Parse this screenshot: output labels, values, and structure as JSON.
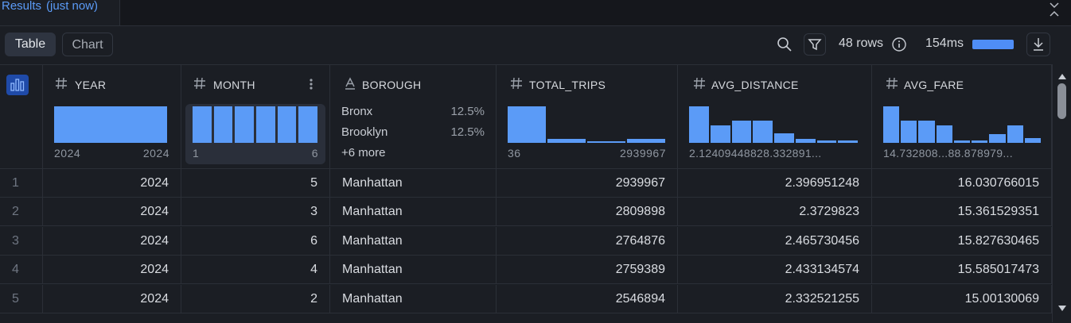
{
  "tab": {
    "title": "Results",
    "status": "(just now)"
  },
  "toolbar": {
    "table_label": "Table",
    "chart_label": "Chart",
    "rows_text": "48 rows",
    "time_text": "154ms",
    "icons": [
      "search-icon",
      "filter-icon",
      "info-icon",
      "download-icon"
    ]
  },
  "columns": [
    {
      "name": "YEAR",
      "type_icon": "hash-icon",
      "range_min": "2024",
      "range_max": "2024"
    },
    {
      "name": "MONTH",
      "type_icon": "hash-icon",
      "range_min": "1",
      "range_max": "6"
    },
    {
      "name": "BOROUGH",
      "type_icon": "text-type-icon",
      "categories": [
        {
          "label": "Bronx",
          "pct": "12.5%"
        },
        {
          "label": "Brooklyn",
          "pct": "12.5%"
        }
      ],
      "more": "+6 more"
    },
    {
      "name": "TOTAL_TRIPS",
      "type_icon": "hash-icon",
      "range_min": "36",
      "range_max": "2939967"
    },
    {
      "name": "AVG_DISTANCE",
      "type_icon": "hash-icon",
      "range_text": "2.12409448828.332891..."
    },
    {
      "name": "AVG_FARE",
      "type_icon": "hash-icon",
      "range_text": "14.732808...88.878979..."
    }
  ],
  "histograms": {
    "year": [
      1
    ],
    "month": [
      1,
      1,
      1,
      1,
      1,
      1
    ],
    "total_trips": [
      1,
      0.1,
      0.05,
      0.1
    ],
    "avg_distance": [
      1,
      0.47,
      0.6,
      0.6,
      0.27,
      0.1,
      0.07,
      0.07
    ],
    "avg_fare": [
      1,
      0.6,
      0.6,
      0.47,
      0.07,
      0.07,
      0.23,
      0.47,
      0.13
    ]
  },
  "rows": [
    {
      "idx": "1",
      "year": "2024",
      "month": "5",
      "borough": "Manhattan",
      "total_trips": "2939967",
      "avg_distance": "2.396951248",
      "avg_fare": "16.030766015"
    },
    {
      "idx": "2",
      "year": "2024",
      "month": "3",
      "borough": "Manhattan",
      "total_trips": "2809898",
      "avg_distance": "2.3729823",
      "avg_fare": "15.361529351"
    },
    {
      "idx": "3",
      "year": "2024",
      "month": "6",
      "borough": "Manhattan",
      "total_trips": "2764876",
      "avg_distance": "2.465730456",
      "avg_fare": "15.827630465"
    },
    {
      "idx": "4",
      "year": "2024",
      "month": "4",
      "borough": "Manhattan",
      "total_trips": "2759389",
      "avg_distance": "2.433134574",
      "avg_fare": "15.585017473"
    },
    {
      "idx": "5",
      "year": "2024",
      "month": "2",
      "borough": "Manhattan",
      "total_trips": "2546894",
      "avg_distance": "2.332521255",
      "avg_fare": "15.00130069"
    }
  ],
  "colors": {
    "accent": "#5b9bf7",
    "background": "#1b1e24",
    "toggle_bg": "#1f4aa8"
  }
}
